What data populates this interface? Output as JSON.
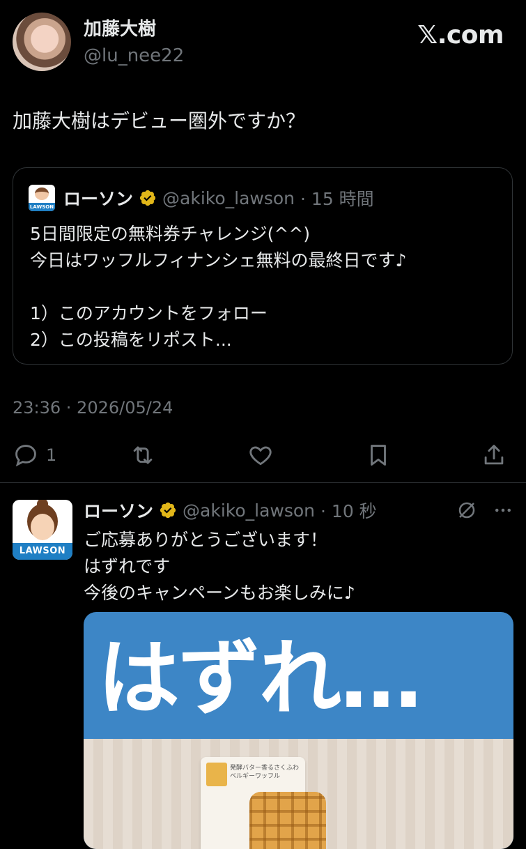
{
  "header": {
    "display_name": "加藤大樹",
    "handle": "@lu_nee22",
    "site_label": "𝕏.com"
  },
  "tweet": {
    "text": "加藤大樹はデビュー圏外ですか？",
    "timestamp": "23:36 · 2026/05/24"
  },
  "quote": {
    "name": "ローソン",
    "handle": "@akiko_lawson",
    "time": "· 15 時間",
    "avatar_band": "LAWSON",
    "body": "5日間限定の無料券チャレンジ(^^)\n今日はワッフルフィナンシェ無料の最終日です♪\n\n1）このアカウントをフォロー\n2）この投稿をリポスト..."
  },
  "actions": {
    "reply_count": "1"
  },
  "reply": {
    "name": "ローソン",
    "handle": "@akiko_lawson",
    "time": "· 10 秒",
    "avatar_band": "LAWSON",
    "body": "ご応募ありがとうございます！\nはずれです\n今後のキャンペーンもお楽しみに♪",
    "media_text": "はずれ…",
    "media_pack_label": "発酵バター香るさくふわベルギーワッフル"
  },
  "colors": {
    "background": "#000000",
    "text": "#e7e9ea",
    "muted": "#71767b",
    "verified_gold": "#e2b719",
    "media_blue": "#3d86c6",
    "lawson_blue": "#1f7fc4"
  }
}
